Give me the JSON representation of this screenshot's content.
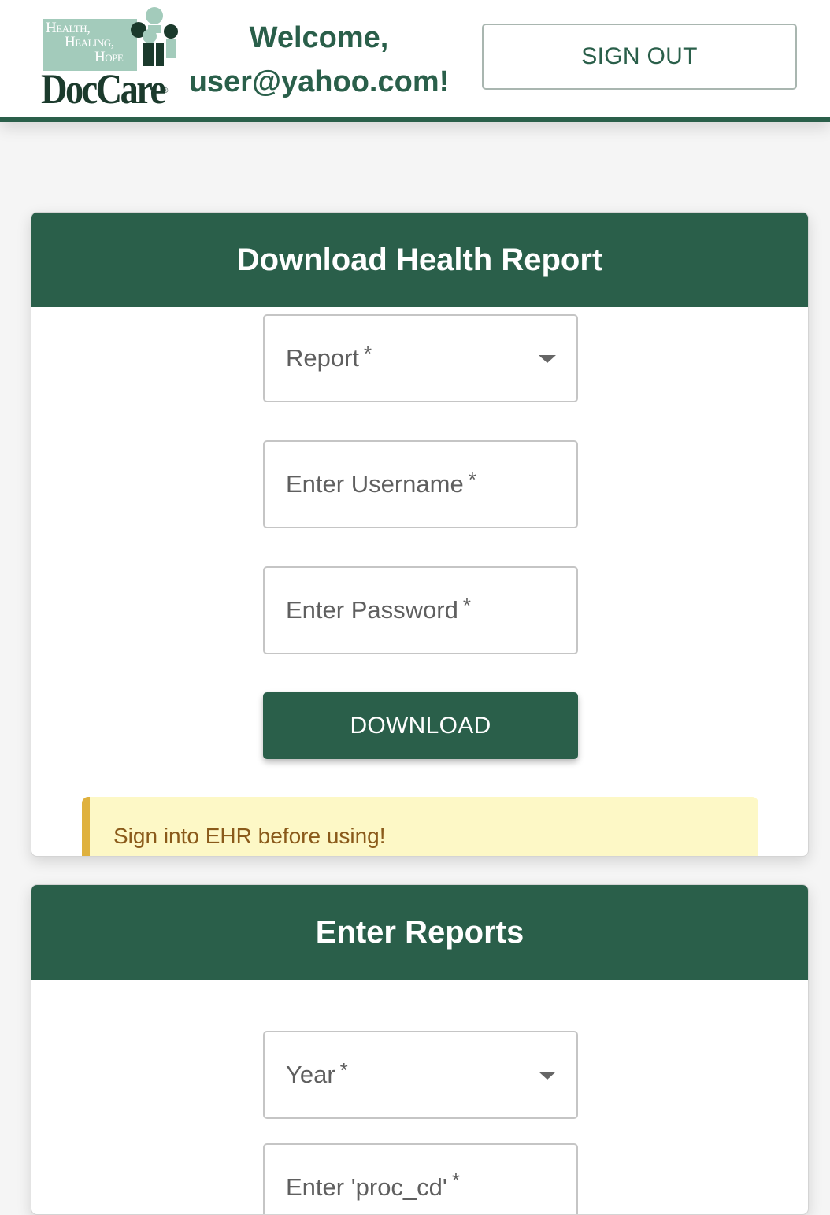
{
  "header": {
    "logo_wordmark": "DocCare",
    "logo_tagline": [
      "Health,",
      "Healing,",
      "Hope"
    ],
    "welcome_line1": "Welcome,",
    "welcome_line2": "user@yahoo.com!",
    "sign_out_label": "SIGN OUT"
  },
  "download_report": {
    "title": "Download Health Report",
    "report_select": {
      "label": "Report",
      "required_mark": "*"
    },
    "username_field": {
      "label": "Enter Username",
      "required_mark": "*"
    },
    "password_field": {
      "label": "Enter Password",
      "required_mark": "*"
    },
    "download_label": "DOWNLOAD",
    "alert_text": "Sign into EHR before using!"
  },
  "enter_reports": {
    "title": "Enter Reports",
    "year_select": {
      "label": "Year",
      "required_mark": "*"
    },
    "proc_cd_field": {
      "label": "Enter 'proc_cd'",
      "required_mark": "*"
    }
  },
  "colors": {
    "brand_green": "#2a5f4a",
    "logo_light_green": "#a3cbbb",
    "alert_bg": "#fdf8c6",
    "alert_accent": "#dfb13e",
    "alert_text": "#8a5a1a"
  },
  "icons": [
    "people-logo-icon",
    "dropdown-caret-icon"
  ]
}
